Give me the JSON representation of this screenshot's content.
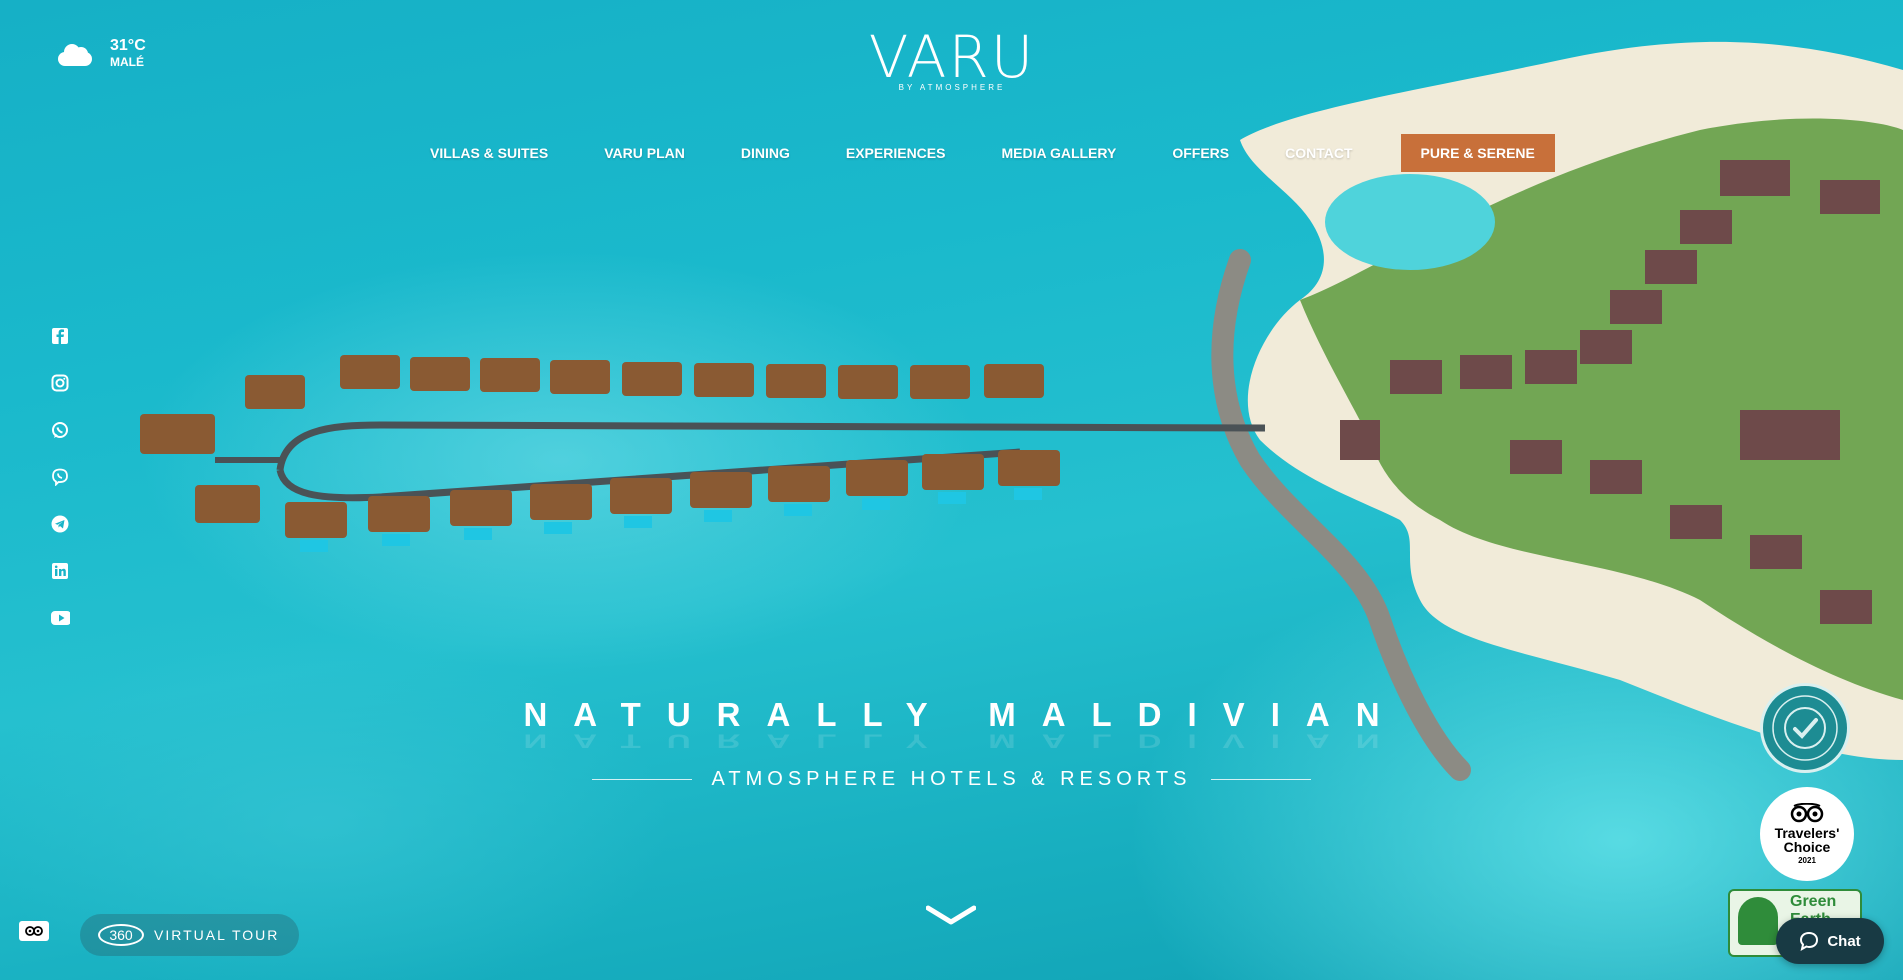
{
  "weather": {
    "temperature": "31°C",
    "city": "MALÉ",
    "icon": "cloud-icon"
  },
  "logo": {
    "wordmark": "VARU",
    "tagline": "BY ATMOSPHERE"
  },
  "nav": {
    "items": [
      "VILLAS & SUITES",
      "VARU PLAN",
      "DINING",
      "EXPERIENCES",
      "MEDIA GALLERY",
      "OFFERS",
      "CONTACT"
    ],
    "cta": "PURE & SERENE",
    "cta_color": "#c8703a"
  },
  "social": [
    "facebook-icon",
    "instagram-icon",
    "whatsapp-icon",
    "viber-icon",
    "telegram-icon",
    "linkedin-icon",
    "youtube-icon"
  ],
  "hero": {
    "title": "NATURALLY MALDIVIAN",
    "subtitle": "ATMOSPHERE HOTELS & RESORTS"
  },
  "virtual_tour": {
    "icon_text": "360",
    "label": "VIRTUAL TOUR"
  },
  "badges": {
    "travelers_choice": {
      "line1": "Travelers'",
      "line2": "Choice",
      "year": "2021"
    },
    "green_earth": {
      "text": "Green Earth"
    }
  },
  "chat": {
    "label": "Chat"
  }
}
